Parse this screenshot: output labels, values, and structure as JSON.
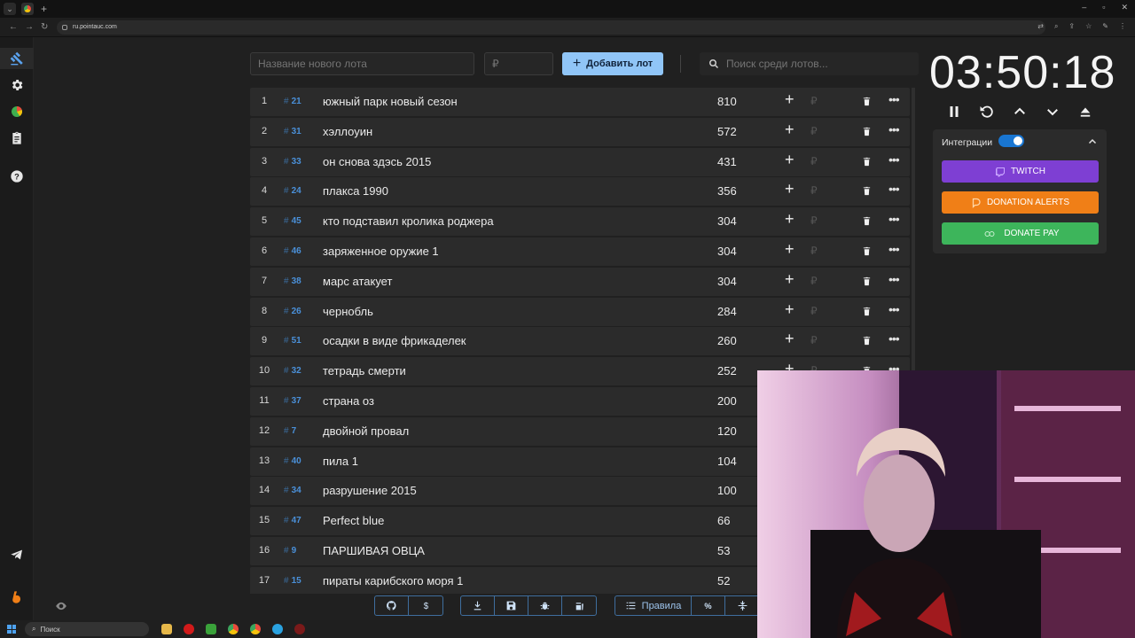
{
  "browser": {
    "url": "ru.pointauc.com"
  },
  "toolbar": {
    "lot_placeholder": "Название нового лота",
    "amount_placeholder": "₽",
    "add_label": "Добавить лот",
    "search_placeholder": "Поиск среди лотов..."
  },
  "lots": [
    {
      "idx": "1",
      "id": "21",
      "name": "южный парк новый сезон",
      "amount": "810"
    },
    {
      "idx": "2",
      "id": "31",
      "name": "хэллоуин",
      "amount": "572"
    },
    {
      "idx": "3",
      "id": "33",
      "name": "он снова здэсь 2015",
      "amount": "431"
    },
    {
      "idx": "4",
      "id": "24",
      "name": "плакса 1990",
      "amount": "356"
    },
    {
      "idx": "5",
      "id": "45",
      "name": "кто подставил кролика роджера",
      "amount": "304"
    },
    {
      "idx": "6",
      "id": "46",
      "name": "заряженное оружие 1",
      "amount": "304"
    },
    {
      "idx": "7",
      "id": "38",
      "name": "марс атакует",
      "amount": "304"
    },
    {
      "idx": "8",
      "id": "26",
      "name": "чернобль",
      "amount": "284"
    },
    {
      "idx": "9",
      "id": "51",
      "name": "осадки в виде фрикаделек",
      "amount": "260"
    },
    {
      "idx": "10",
      "id": "32",
      "name": "тетрадь смерти",
      "amount": "252"
    },
    {
      "idx": "11",
      "id": "37",
      "name": "страна оз",
      "amount": "200"
    },
    {
      "idx": "12",
      "id": "7",
      "name": " двойной провал",
      "amount": "120"
    },
    {
      "idx": "13",
      "id": "40",
      "name": "пила 1",
      "amount": "104"
    },
    {
      "idx": "14",
      "id": "34",
      "name": "разрушение 2015",
      "amount": "100"
    },
    {
      "idx": "15",
      "id": "47",
      "name": "Perfect blue",
      "amount": "66"
    },
    {
      "idx": "16",
      "id": "9",
      "name": "ПАРШИВАЯ ОВЦА",
      "amount": "53"
    },
    {
      "idx": "17",
      "id": "15",
      "name": "пираты карибского моря 1",
      "amount": "52"
    }
  ],
  "currency_symbol": "₽",
  "timer": {
    "value": "03:50:18"
  },
  "integrations": {
    "title": "Интеграции",
    "enabled": true,
    "twitch_label": "TWITCH",
    "donation_alerts_label": "DONATION ALERTS",
    "donate_pay_label": "DONATE PAY"
  },
  "bottom_bar": {
    "rules_label": "Правила"
  },
  "taskbar": {
    "search_label": "Поиск"
  },
  "colors": {
    "accent": "#90c5f7",
    "twitch": "#7e3fd3",
    "donation_alerts": "#f07f17",
    "donate_pay": "#3db55b",
    "lot_id": "#4a90d9"
  }
}
